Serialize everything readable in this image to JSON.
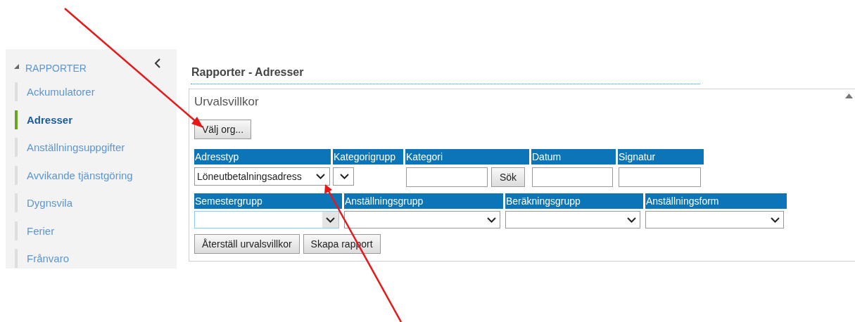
{
  "sidebar": {
    "section": {
      "label": "RAPPORTER",
      "expanded": true
    },
    "items": [
      {
        "label": "Ackumulatorer",
        "selected": false
      },
      {
        "label": "Adresser",
        "selected": true
      },
      {
        "label": "Anställningsuppgifter",
        "selected": false
      },
      {
        "label": "Avvikande tjänstgöring",
        "selected": false
      },
      {
        "label": "Dygnsvila",
        "selected": false
      },
      {
        "label": "Ferier",
        "selected": false
      },
      {
        "label": "Frånvaro",
        "selected": false
      }
    ]
  },
  "page_title": "Rapporter - Adresser",
  "panel": {
    "title": "Urvalsvillkor",
    "org_button": "Välj org...",
    "row_1": [
      {
        "kind": "select",
        "label": "Adresstyp",
        "value": "Löneutbetalningsadress"
      },
      {
        "kind": "select",
        "label": "Kategorigrupp"
      },
      {
        "kind": "search",
        "label": "Kategori",
        "button": "Sök"
      },
      {
        "kind": "input",
        "label": "Datum"
      },
      {
        "kind": "input",
        "label": "Signatur"
      }
    ],
    "row_2": [
      {
        "kind": "select",
        "label": "Semestergrupp",
        "focused": true
      },
      {
        "kind": "select",
        "label": "Anställningsgrupp",
        "focused": false
      },
      {
        "kind": "select",
        "label": "Beräkningsgrupp",
        "focused": false
      },
      {
        "kind": "select",
        "label": "Anställningsform",
        "focused": false
      }
    ],
    "buttons": [
      "Återställ urvalsvillkor",
      "Skapa rapport"
    ]
  }
}
